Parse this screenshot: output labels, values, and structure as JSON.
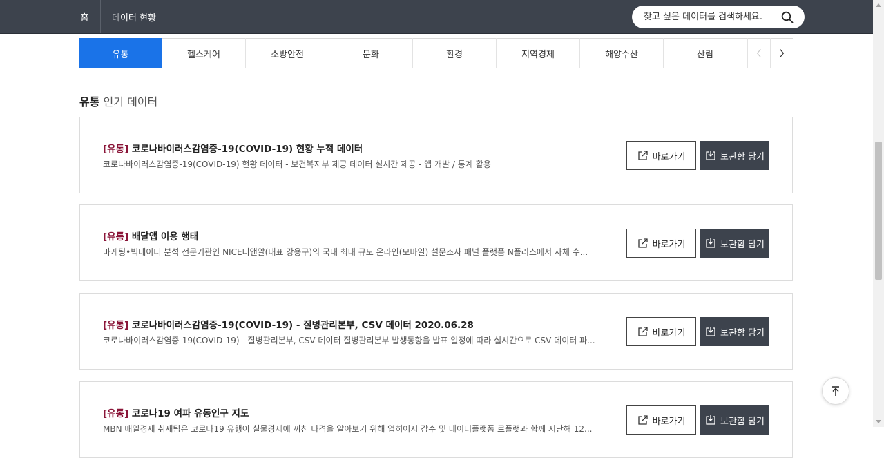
{
  "header": {
    "home_label": "홈",
    "current_label": "데이터 현황",
    "search_placeholder": "찾고 싶은 데이터를 검색하세요."
  },
  "tabs": [
    {
      "label": "유통",
      "active": true
    },
    {
      "label": "헬스케어"
    },
    {
      "label": "소방안전"
    },
    {
      "label": "문화"
    },
    {
      "label": "환경"
    },
    {
      "label": "지역경제"
    },
    {
      "label": "해양수산"
    },
    {
      "label": "산림"
    }
  ],
  "section": {
    "title_bold": "유통",
    "title_rest": " 인기 데이터"
  },
  "cards": [
    {
      "tag": "[유통]",
      "title": " 코로나바이러스감염증-19(COVID-19) 현황 누적 데이터",
      "desc": "코로나바이러스감염증-19(COVID-19) 현황 데이터 - 보건복지부 제공 데이터 실시간 제공 - 앱 개발 / 통계 활용"
    },
    {
      "tag": "[유통]",
      "title": " 배달앱 이용 행태",
      "desc": "마케팅•빅데이터 분석 전문기관인 NICE디앤알(대표 강용구)의 국내 최대 규모 온라인(모바일) 설문조사 패널 플랫폼 N플러스에서 자체 수..."
    },
    {
      "tag": "[유통]",
      "title": " 코로나바이러스감염증-19(COVID-19) - 질병관리본부, CSV 데이터 2020.06.28",
      "desc": "코로나바이러스감염증-19(COVID-19) - 질병관리본부, CSV 데이터 질병관리본부 발생동향을 발표 일정에 따라 실시간으로 CSV 데이터 파..."
    },
    {
      "tag": "[유통]",
      "title": " 코로나19 여파 유동인구 지도",
      "desc": "MBN 매일경제 취재팀은 코로나19 유행이 실물경제에 끼친 타격을 알아보기 위해 업히어시 감수 및 데이터플랫폼 로플랫과 함께 지난해 12..."
    }
  ],
  "buttons": {
    "go_label": "바로가기",
    "save_label": "보관함 담기"
  },
  "colors": {
    "header_bg": "#3d434d",
    "tab_active": "#1a73e8",
    "tag": "#8a1538"
  }
}
